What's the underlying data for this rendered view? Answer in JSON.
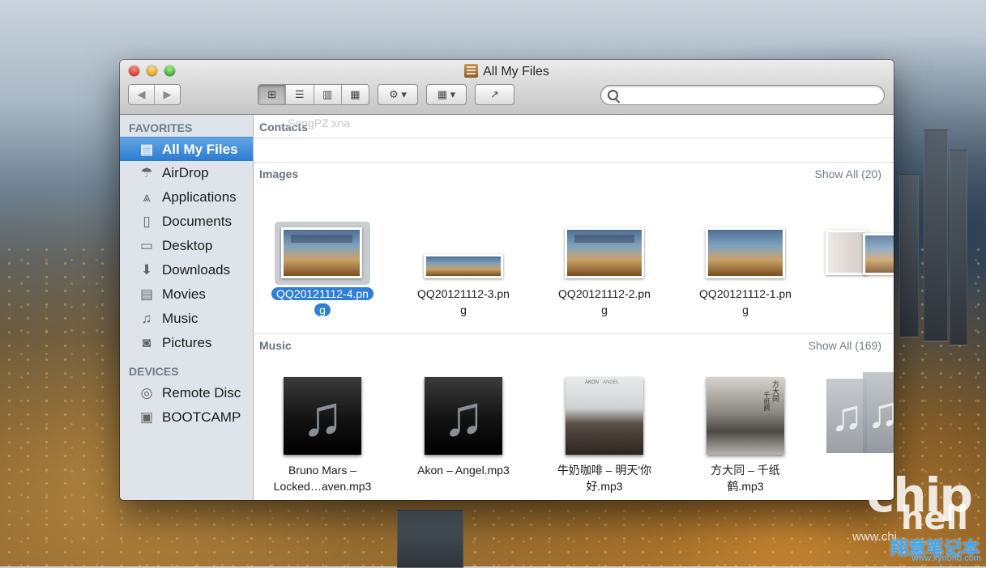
{
  "window": {
    "title": "All My Files"
  },
  "toolbar": {
    "back": "◀",
    "forward": "▶",
    "views": [
      {
        "name": "icon-view",
        "glyph": "⊞"
      },
      {
        "name": "list-view",
        "glyph": "☰"
      },
      {
        "name": "column-view",
        "glyph": "▥"
      },
      {
        "name": "coverflow-view",
        "glyph": "▦"
      }
    ],
    "action": "⚙ ▾",
    "arrange": "▦ ▾",
    "share": "↗"
  },
  "search": {
    "value": "",
    "placeholder": ""
  },
  "sidebar": {
    "favorites_header": "FAVORITES",
    "devices_header": "DEVICES",
    "favorites": [
      {
        "label": "All My Files",
        "icon": "all-files-icon",
        "glyph": "▤"
      },
      {
        "label": "AirDrop",
        "icon": "airdrop-icon",
        "glyph": "☂"
      },
      {
        "label": "Applications",
        "icon": "applications-icon",
        "glyph": "⩓"
      },
      {
        "label": "Documents",
        "icon": "documents-icon",
        "glyph": "▯"
      },
      {
        "label": "Desktop",
        "icon": "desktop-icon",
        "glyph": "▭"
      },
      {
        "label": "Downloads",
        "icon": "downloads-icon",
        "glyph": "⬇"
      },
      {
        "label": "Movies",
        "icon": "movies-icon",
        "glyph": "▤"
      },
      {
        "label": "Music",
        "icon": "music-icon",
        "glyph": "♫"
      },
      {
        "label": "Pictures",
        "icon": "pictures-icon",
        "glyph": "◙"
      }
    ],
    "devices": [
      {
        "label": "Remote Disc",
        "icon": "remote-disc-icon",
        "glyph": "◎"
      },
      {
        "label": "BOOTCAMP",
        "icon": "bootcamp-drive-icon",
        "glyph": "▣"
      }
    ]
  },
  "main": {
    "contacts": {
      "title": "Contacts",
      "ghost": "SongPZ xna"
    },
    "images": {
      "title": "Images",
      "show_all": "Show All (20)",
      "items": [
        {
          "name_line1": "QQ20121112-4.pn",
          "name_line2": "g"
        },
        {
          "name_line1": "QQ20121112-3.pn",
          "name_line2": "g"
        },
        {
          "name_line1": "QQ20121112-2.pn",
          "name_line2": "g"
        },
        {
          "name_line1": "QQ20121112-1.pn",
          "name_line2": "g"
        }
      ]
    },
    "music": {
      "title": "Music",
      "show_all": "Show All (169)",
      "items": [
        {
          "name_line1": "Bruno Mars –",
          "name_line2": "Locked…aven.mp3"
        },
        {
          "name_line1": "Akon – Angel.mp3",
          "name_line2": ""
        },
        {
          "name_line1": "牛奶咖啡 – 明天'你",
          "name_line2": "好.mp3"
        },
        {
          "name_line1": "方大同 – 千纸",
          "name_line2": "鹤.mp3"
        }
      ],
      "album_text": {
        "akon_artist": "AKON",
        "akon_title": "ANGEL",
        "fang_artist": "方大同",
        "fang_title": "千纸鹤"
      }
    }
  },
  "watermark": {
    "brand": "chip",
    "brand2": "hell",
    "site_cn": "翔意笔记本",
    "site_url": "www.xynbnb.com",
    "site_chi": "www.chi"
  }
}
